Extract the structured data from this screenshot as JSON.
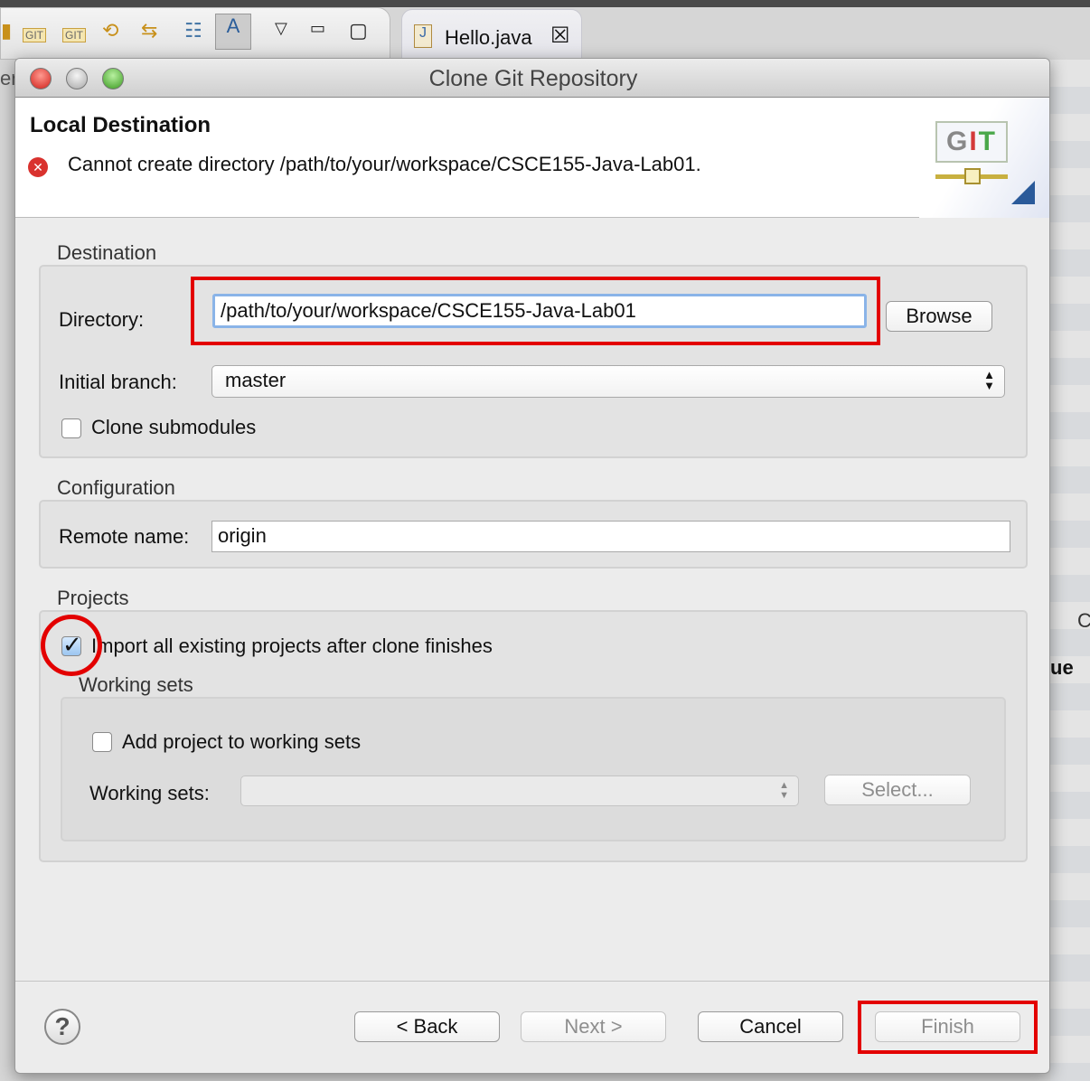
{
  "editor": {
    "tab_label": "Hello.java",
    "left_cut_text": "ers",
    "right_cut_text_1": "C",
    "right_cut_text_2": "ue"
  },
  "dialog": {
    "title": "Clone Git Repository",
    "header": {
      "title": "Local Destination",
      "error_message": "Cannot create directory /path/to/your/workspace/CSCE155-Java-Lab01.",
      "logo_text": "GIT"
    },
    "destination": {
      "group_label": "Destination",
      "directory_label": "Directory:",
      "directory_value": "/path/to/your/workspace/CSCE155-Java-Lab01",
      "browse_label": "Browse",
      "branch_label": "Initial branch:",
      "branch_value": "master",
      "clone_submodules_label": "Clone submodules",
      "clone_submodules_checked": false
    },
    "configuration": {
      "group_label": "Configuration",
      "remote_label": "Remote name:",
      "remote_value": "origin"
    },
    "projects": {
      "group_label": "Projects",
      "import_label": "Import all existing projects after clone finishes",
      "import_checked": true,
      "working_sets_label": "Working sets",
      "add_label": "Add project to working sets",
      "add_checked": false,
      "sets_label": "Working sets:",
      "sets_value": "",
      "select_label": "Select..."
    },
    "buttons": {
      "back": "< Back",
      "next": "Next >",
      "cancel": "Cancel",
      "finish": "Finish"
    }
  },
  "colors": {
    "annotation": "#e30000",
    "error": "#d9322e"
  }
}
